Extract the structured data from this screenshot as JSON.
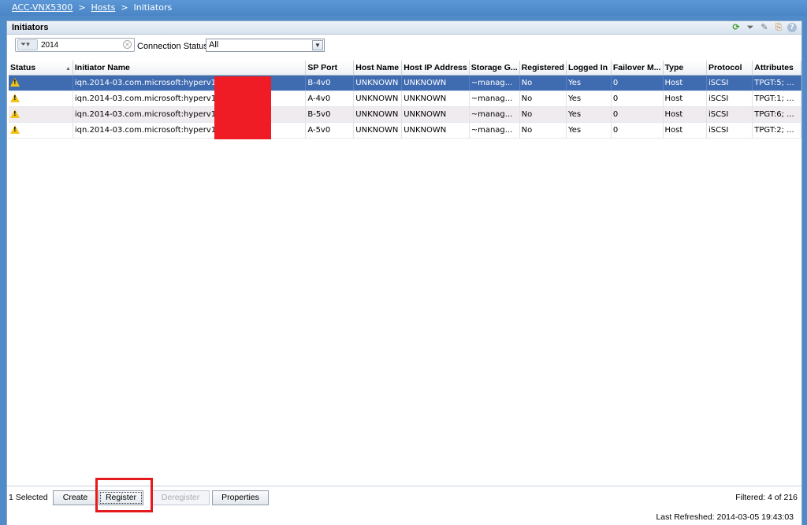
{
  "breadcrumb": {
    "items": [
      "ACC-VNX5300",
      "Hosts",
      "Initiators"
    ],
    "separator": ">"
  },
  "panel": {
    "title": "Initiators",
    "header_icons": [
      "refresh-icon",
      "filter-icon",
      "wrench-icon",
      "export-icon",
      "help-icon"
    ]
  },
  "filter": {
    "value": "2014",
    "connection_status_label": "Connection Status",
    "connection_status_value": "All"
  },
  "table": {
    "columns": [
      "Status",
      "Initiator Name",
      "SP Port",
      "Host Name",
      "Host IP Address",
      "Storage G...",
      "Registered",
      "Logged In",
      "Failover M...",
      "Type",
      "Protocol",
      "Attributes"
    ],
    "rows": [
      {
        "status": "warning",
        "initiator": "iqn.2014-03.com.microsoft:hyperv1",
        "sp_port": "B-4v0",
        "host_name": "UNKNOWN",
        "host_ip": "UNKNOWN",
        "storage_group": "~manag...",
        "registered": "No",
        "logged_in": "Yes",
        "failover": "0",
        "type": "Host",
        "protocol": "iSCSI",
        "attributes": "TPGT:5; ..."
      },
      {
        "status": "warning",
        "initiator": "iqn.2014-03.com.microsoft:hyperv1",
        "sp_port": "A-4v0",
        "host_name": "UNKNOWN",
        "host_ip": "UNKNOWN",
        "storage_group": "~manag...",
        "registered": "No",
        "logged_in": "Yes",
        "failover": "0",
        "type": "Host",
        "protocol": "iSCSI",
        "attributes": "TPGT:1; ..."
      },
      {
        "status": "warning",
        "initiator": "iqn.2014-03.com.microsoft:hyperv1",
        "sp_port": "B-5v0",
        "host_name": "UNKNOWN",
        "host_ip": "UNKNOWN",
        "storage_group": "~manag...",
        "registered": "No",
        "logged_in": "Yes",
        "failover": "0",
        "type": "Host",
        "protocol": "iSCSI",
        "attributes": "TPGT:6; ..."
      },
      {
        "status": "warning",
        "initiator": "iqn.2014-03.com.microsoft:hyperv1",
        "sp_port": "A-5v0",
        "host_name": "UNKNOWN",
        "host_ip": "UNKNOWN",
        "storage_group": "~manag...",
        "registered": "No",
        "logged_in": "Yes",
        "failover": "0",
        "type": "Host",
        "protocol": "iSCSI",
        "attributes": "TPGT:2; ..."
      }
    ]
  },
  "footer": {
    "selected": "1 Selected",
    "buttons": {
      "create": "Create",
      "register": "Register",
      "deregister": "Deregister",
      "properties": "Properties"
    },
    "filtered": "Filtered: 4 of 216",
    "last_refreshed": "Last Refreshed: 2014-03-05 19:43:03"
  },
  "colors": {
    "selected_row": "#3f6bb1",
    "highlight": "#e41a1c",
    "redaction": "#ef1c25",
    "warning": "#f0c419"
  }
}
